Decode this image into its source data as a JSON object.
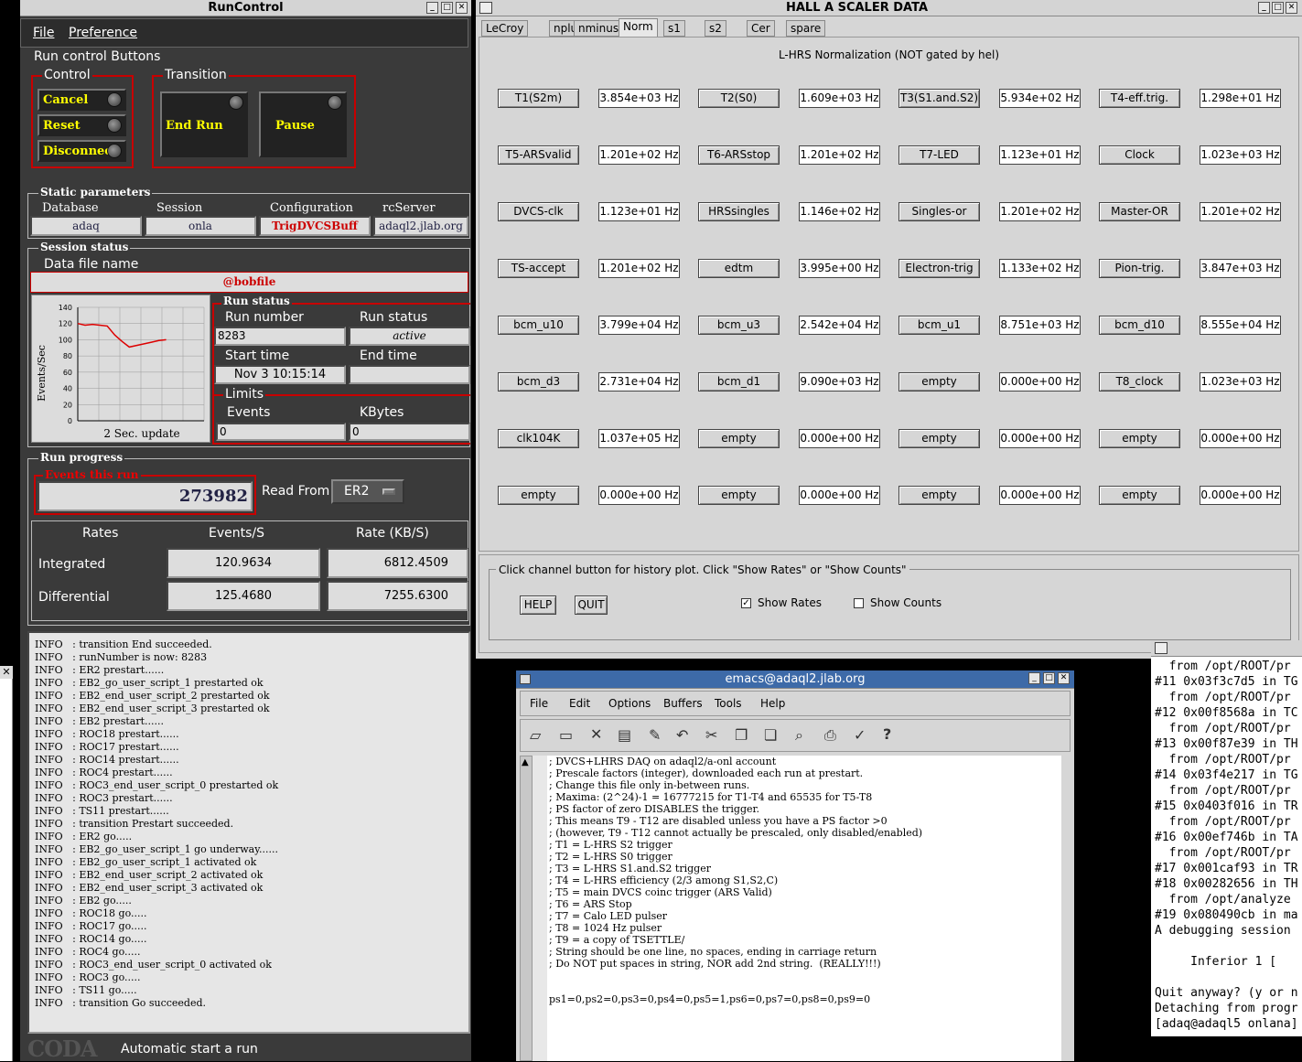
{
  "rc": {
    "title": "RunControl",
    "menu": {
      "file": "File",
      "pref": "Preference"
    },
    "buttons_title": "Run control Buttons",
    "control_title": "Control",
    "transition_title": "Transition",
    "cancel": "Cancel",
    "reset": "Reset",
    "disconnect": "Disconnect",
    "endrun": "End Run",
    "pause": "Pause",
    "static_title": "Static parameters",
    "db_label": "Database",
    "db": "adaq",
    "session_label": "Session",
    "session": "onla",
    "config_label": "Configuration",
    "config": "TrigDVCSBuff",
    "server_label": "rcServer",
    "server": "adaql2.jlab.org",
    "session_status": "Session status",
    "datafile_label": "Data file name",
    "datafile": "@bobfile",
    "graph": {
      "ylabel": "Events/Sec",
      "caption": "2 Sec. update",
      "yticks": [
        "140",
        "120",
        "100",
        "80",
        "60",
        "40",
        "20",
        "0"
      ],
      "values": [
        120,
        118,
        119,
        118,
        117,
        106,
        98,
        91,
        93,
        95,
        97,
        99,
        100
      ]
    },
    "run_status_title": "Run status",
    "runnum_label": "Run number",
    "runnum": "8283",
    "runstatus_label": "Run status",
    "runstatus": "active",
    "start_label": "Start time",
    "start": "Nov 3 10:15:14",
    "end_label": "End time",
    "end": "",
    "limits_title": "Limits",
    "events_label": "Events",
    "events": "0",
    "kbytes_label": "KBytes",
    "kbytes": "0",
    "progress_title": "Run progress",
    "events_run_label": "Events this run",
    "events_run": "273982",
    "read_from_label": "Read From:",
    "read_from": "ER2",
    "rates": {
      "h1": "Rates",
      "h2": "Events/S",
      "h3": "Rate (KB/S)",
      "r1": "Integrated",
      "r1a": "120.9634",
      "r1b": "6812.4509",
      "r2": "Differential",
      "r2a": "125.4680",
      "r2b": "7255.6300"
    },
    "log": "INFO   : transition End succeeded.\nINFO   : runNumber is now: 8283\nINFO   : ER2 prestart......\nINFO   : EB2_go_user_script_1 prestarted ok\nINFO   : EB2_end_user_script_2 prestarted ok\nINFO   : EB2_end_user_script_3 prestarted ok\nINFO   : EB2 prestart......\nINFO   : ROC18 prestart......\nINFO   : ROC17 prestart......\nINFO   : ROC14 prestart......\nINFO   : ROC4 prestart......\nINFO   : ROC3_end_user_script_0 prestarted ok\nINFO   : ROC3 prestart......\nINFO   : TS11 prestart......\nINFO   : transition Prestart succeeded.\nINFO   : ER2 go.....\nINFO   : EB2_go_user_script_1 go underway......\nINFO   : EB2_go_user_script_1 activated ok\nINFO   : EB2_end_user_script_2 activated ok\nINFO   : EB2_end_user_script_3 activated ok\nINFO   : EB2 go.....\nINFO   : ROC18 go.....\nINFO   : ROC17 go.....\nINFO   : ROC14 go.....\nINFO   : ROC4 go.....\nINFO   : ROC3_end_user_script_0 activated ok\nINFO   : ROC3 go.....\nINFO   : TS11 go.....\nINFO   : transition Go succeeded.",
    "coda": "CODA",
    "footer": "Automatic start a run"
  },
  "sc": {
    "title": "HALL  A  SCALER  DATA",
    "tabs": [
      "LeCroy",
      "nplus",
      "nminus",
      "Norm",
      "s1",
      "s2",
      "Cer",
      "spare"
    ],
    "heading": "L-HRS Normalization (NOT gated by hel)",
    "rows": [
      [
        [
          "T1(S2m)",
          "3.854e+03 Hz"
        ],
        [
          "T2(S0)",
          "1.609e+03 Hz"
        ],
        [
          "T3(S1.and.S2)",
          "5.934e+02 Hz"
        ],
        [
          "T4-eff.trig.",
          "1.298e+01 Hz"
        ]
      ],
      [
        [
          "T5-ARSvalid",
          "1.201e+02 Hz"
        ],
        [
          "T6-ARSstop",
          "1.201e+02 Hz"
        ],
        [
          "T7-LED",
          "1.123e+01 Hz"
        ],
        [
          "Clock",
          "1.023e+03 Hz"
        ]
      ],
      [
        [
          "DVCS-clk",
          "1.123e+01 Hz"
        ],
        [
          "HRSsingles",
          "1.146e+02 Hz"
        ],
        [
          "Singles-or",
          "1.201e+02 Hz"
        ],
        [
          "Master-OR",
          "1.201e+02 Hz"
        ]
      ],
      [
        [
          "TS-accept",
          "1.201e+02 Hz"
        ],
        [
          "edtm",
          "3.995e+00 Hz"
        ],
        [
          "Electron-trig",
          "1.133e+02 Hz"
        ],
        [
          "Pion-trig.",
          "3.847e+03 Hz"
        ]
      ],
      [
        [
          "bcm_u10",
          "3.799e+04 Hz"
        ],
        [
          "bcm_u3",
          "2.542e+04 Hz"
        ],
        [
          "bcm_u1",
          "8.751e+03 Hz"
        ],
        [
          "bcm_d10",
          "8.555e+04 Hz"
        ]
      ],
      [
        [
          "bcm_d3",
          "2.731e+04 Hz"
        ],
        [
          "bcm_d1",
          "9.090e+03 Hz"
        ],
        [
          "empty",
          "0.000e+00 Hz"
        ],
        [
          "T8_clock",
          "1.023e+03 Hz"
        ]
      ],
      [
        [
          "clk104K",
          "1.037e+05 Hz"
        ],
        [
          "empty",
          "0.000e+00 Hz"
        ],
        [
          "empty",
          "0.000e+00 Hz"
        ],
        [
          "empty",
          "0.000e+00 Hz"
        ]
      ],
      [
        [
          "empty",
          "0.000e+00 Hz"
        ],
        [
          "empty",
          "0.000e+00 Hz"
        ],
        [
          "empty",
          "0.000e+00 Hz"
        ],
        [
          "empty",
          "0.000e+00 Hz"
        ]
      ]
    ],
    "hint": "Click channel button for history plot.  Click \"Show Rates\" or \"Show Counts\"",
    "help": "HELP",
    "quit": "QUIT",
    "show_rates": "Show Rates",
    "show_counts": "Show Counts"
  },
  "em": {
    "title": "emacs@adaql2.jlab.org",
    "menu": [
      "File",
      "Edit",
      "Options",
      "Buffers",
      "Tools",
      "Help"
    ],
    "text": "; DVCS+LHRS DAQ on adaql2/a-onl account\n; Prescale factors (integer), downloaded each run at prestart.\n; Change this file only in-between runs.\n; Maxima: (2^24)-1 = 16777215 for T1-T4 and 65535 for T5-T8\n; PS factor of zero DISABLES the trigger.\n; This means T9 - T12 are disabled unless you have a PS factor >0\n; (however, T9 - T12 cannot actually be prescaled, only disabled/enabled)\n; T1 = L-HRS S2 trigger\n; T2 = L-HRS S0 trigger\n; T3 = L-HRS S1.and.S2 trigger\n; T4 = L-HRS efficiency (2/3 among S1,S2,C)\n; T5 = main DVCS coinc trigger (ARS Valid)\n; T6 = ARS Stop\n; T7 = Calo LED pulser\n; T8 = 1024 Hz pulser\n; T9 = a copy of TSETTLE/\n; String should be one line, no spaces, ending in carriage return\n; Do NOT put spaces in string, NOR add 2nd string.  (REALLY!!!)\n\n\nps1=0,ps2=0,ps3=0,ps4=0,ps5=1,ps6=0,ps7=0,ps8=0,ps9=0"
  },
  "lg": {
    "text": "  from /opt/ROOT/pr\n#11 0x03f3c7d5 in TG\n  from /opt/ROOT/pr\n#12 0x00f8568a in TC\n  from /opt/ROOT/pr\n#13 0x00f87e39 in TH\n  from /opt/ROOT/pr\n#14 0x03f4e217 in TG\n  from /opt/ROOT/pr\n#15 0x0403f016 in TR\n  from /opt/ROOT/pr\n#16 0x00ef746b in TA\n  from /opt/ROOT/pr\n#17 0x001caf93 in TR\n#18 0x00282656 in TH\n  from /opt/analyze\n#19 0x080490cb in ma\nA debugging session\n\n     Inferior 1 [\n\nQuit anyway? (y or n\nDetaching from progr\n[adaq@adaql5 onlana]"
  }
}
